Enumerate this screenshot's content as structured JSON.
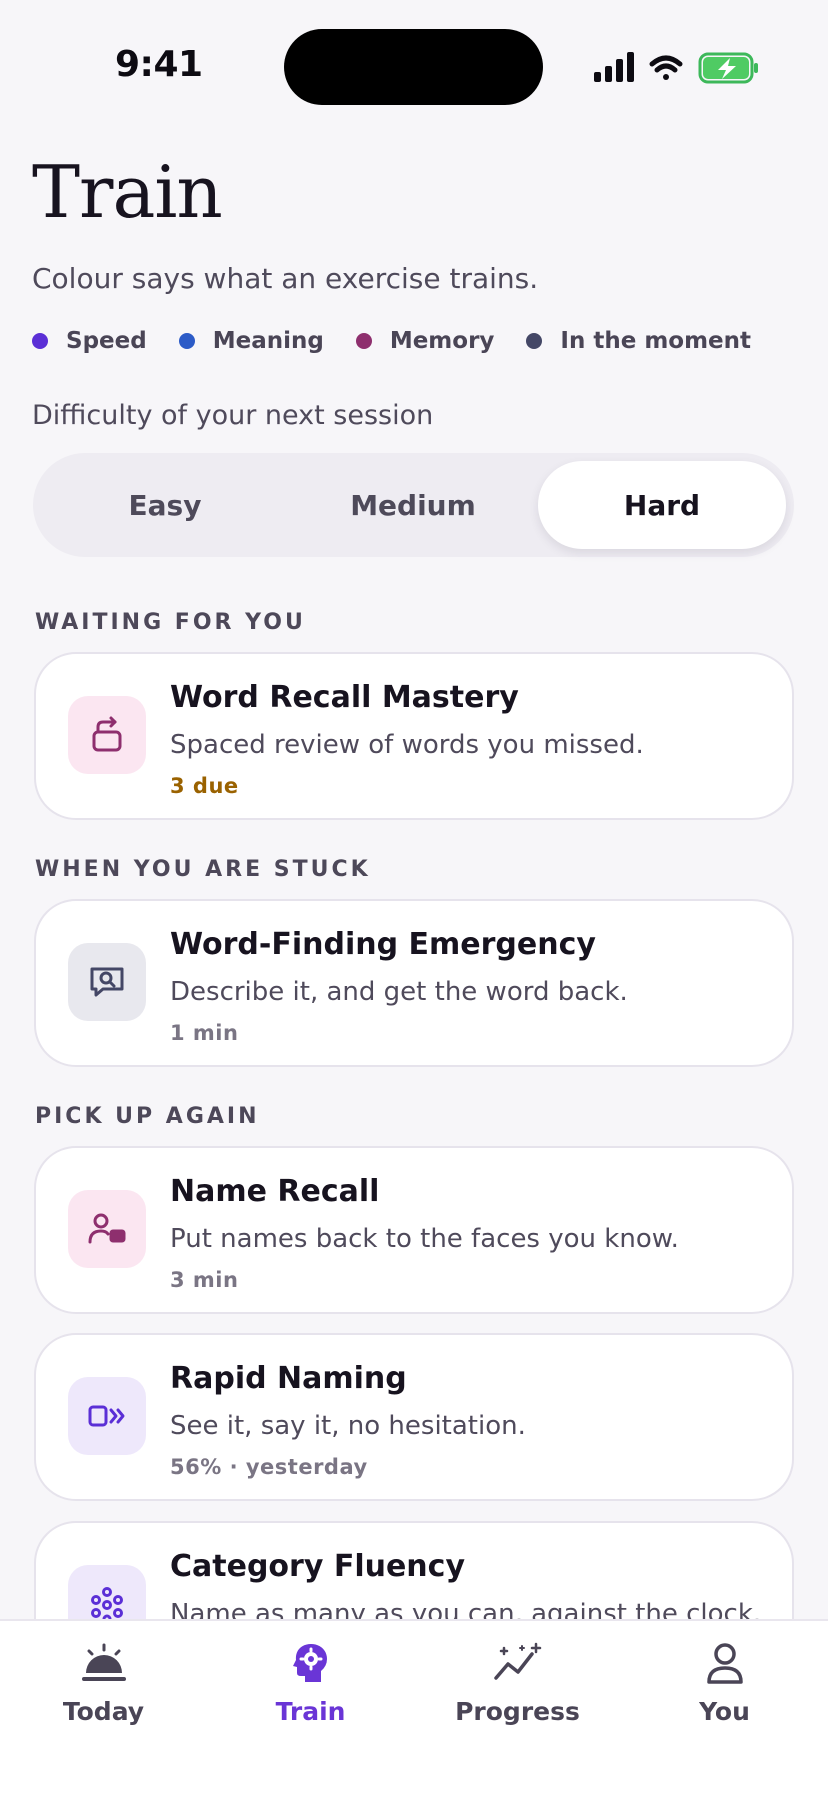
{
  "status_bar": {
    "time": "9:41"
  },
  "header": {
    "title": "Train",
    "subtitle": "Colour says what an exercise trains."
  },
  "legend": [
    {
      "label": "Speed",
      "color": "#5B2FD6"
    },
    {
      "label": "Meaning",
      "color": "#2C5BC7"
    },
    {
      "label": "Memory",
      "color": "#8E2F6E"
    },
    {
      "label": "In the moment",
      "color": "#444766"
    }
  ],
  "difficulty": {
    "label": "Difficulty of your next session",
    "options": [
      "Easy",
      "Medium",
      "Hard"
    ],
    "selected": "Hard"
  },
  "sections": {
    "waiting": "WAITING FOR YOU",
    "stuck": "WHEN YOU ARE STUCK",
    "pickup": "PICK UP AGAIN"
  },
  "cards": [
    {
      "title": "Word Recall Mastery",
      "desc": "Spaced review of words you missed.",
      "meta": "3 due",
      "icon": "review-cycle-icon",
      "accent": "#8E2F6E"
    },
    {
      "title": "Word-Finding Emergency",
      "desc": "Describe it, and get the word back.",
      "meta": "1 min",
      "icon": "speech-search-icon",
      "accent": "#444766"
    },
    {
      "title": "Name Recall",
      "desc": "Put names back to the faces you know.",
      "meta": "3 min",
      "icon": "person-tag-icon",
      "accent": "#8E2F6E"
    },
    {
      "title": "Rapid Naming",
      "desc": "See it, say it, no hesitation.",
      "meta": "56% · yesterday",
      "icon": "fast-forward-card-icon",
      "accent": "#5B2FD6"
    },
    {
      "title": "Category Fluency",
      "desc": "Name as many as you can, against the clock.",
      "meta": "",
      "icon": "dots-cluster-icon",
      "accent": "#5B2FD6"
    }
  ],
  "tabbar": {
    "items": [
      {
        "label": "Today",
        "icon": "sunrise-icon"
      },
      {
        "label": "Train",
        "icon": "brain-gear-icon"
      },
      {
        "label": "Progress",
        "icon": "sparkle-chart-icon"
      },
      {
        "label": "You",
        "icon": "person-icon"
      }
    ],
    "active": "Train"
  }
}
